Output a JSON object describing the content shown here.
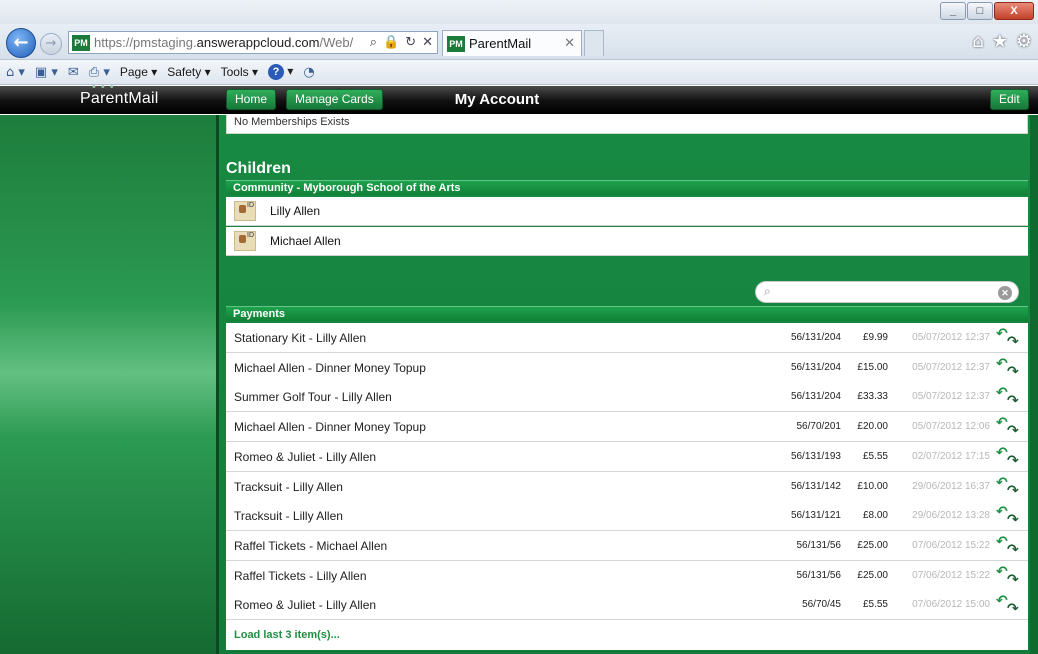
{
  "browser": {
    "url_prefix": "https://pmstaging.",
    "url_host": "answerappcloud.com",
    "url_path": "/Web/",
    "favicon_text": "PM",
    "tab_label": "ParentMail",
    "window_buttons": [
      "_",
      "□",
      "X"
    ],
    "menu": {
      "page": "Page",
      "safety": "Safety",
      "tools": "Tools"
    }
  },
  "app": {
    "logo": "ParentMail",
    "home_label": "Home",
    "manage_cards_label": "Manage Cards",
    "title": "My Account",
    "edit_label": "Edit"
  },
  "memberships": {
    "empty_text": "No Memberships Exists"
  },
  "children": {
    "title": "Children",
    "group": "Community - Myborough School of the Arts",
    "items": [
      {
        "name": "Lilly Allen",
        "icon_tag": "ID"
      },
      {
        "name": "Michael Allen",
        "icon_tag": "ID"
      }
    ]
  },
  "search": {
    "placeholder": ""
  },
  "payments": {
    "title": "Payments",
    "rows": [
      {
        "desc": "Stationary Kit - Lilly Allen",
        "ref": "56/131/204",
        "amount": "£9.99",
        "date": "05/07/2012 12:37"
      },
      {
        "desc": "Michael Allen - Dinner Money Topup",
        "ref": "56/131/204",
        "amount": "£15.00",
        "date": "05/07/2012 12:37"
      },
      {
        "desc": "Summer Golf Tour - Lilly Allen",
        "ref": "56/131/204",
        "amount": "£33.33",
        "date": "05/07/2012 12:37"
      },
      {
        "desc": "Michael Allen - Dinner Money Topup",
        "ref": "56/70/201",
        "amount": "£20.00",
        "date": "05/07/2012 12:06"
      },
      {
        "desc": "Romeo & Juliet - Lilly Allen",
        "ref": "56/131/193",
        "amount": "£5.55",
        "date": "02/07/2012 17:15"
      },
      {
        "desc": "Tracksuit - Lilly Allen",
        "ref": "56/131/142",
        "amount": "£10.00",
        "date": "29/06/2012 16:37"
      },
      {
        "desc": "Tracksuit - Lilly Allen",
        "ref": "56/131/121",
        "amount": "£8.00",
        "date": "29/06/2012 13:28"
      },
      {
        "desc": "Raffel Tickets - Michael Allen",
        "ref": "56/131/56",
        "amount": "£25.00",
        "date": "07/06/2012 15:22"
      },
      {
        "desc": "Raffel Tickets - Lilly Allen",
        "ref": "56/131/56",
        "amount": "£25.00",
        "date": "07/06/2012 15:22"
      },
      {
        "desc": "Romeo & Juliet - Lilly Allen",
        "ref": "56/70/45",
        "amount": "£5.55",
        "date": "07/06/2012 15:00"
      }
    ],
    "load_more": "Load last 3 item(s)..."
  },
  "icons": {
    "back": "back-arrow-icon",
    "forward": "forward-arrow-icon",
    "refund": "refund-icon",
    "child": "id-card-icon"
  },
  "colors": {
    "brand_green": "#188a42",
    "header_black": "#111111"
  }
}
